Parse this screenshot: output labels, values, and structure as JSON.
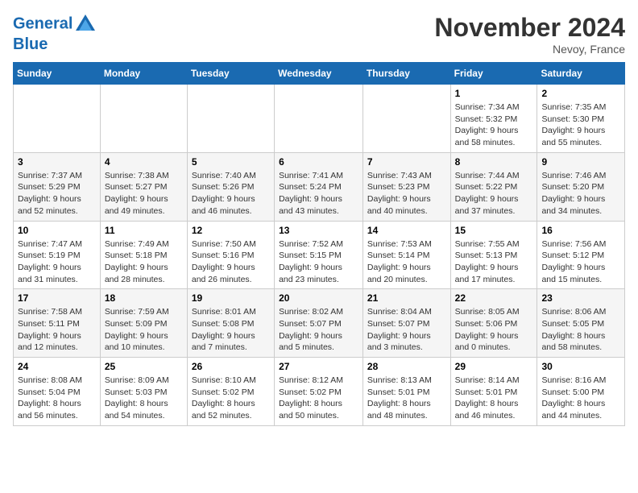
{
  "header": {
    "logo_line1": "General",
    "logo_line2": "Blue",
    "month": "November 2024",
    "location": "Nevoy, France"
  },
  "days_of_week": [
    "Sunday",
    "Monday",
    "Tuesday",
    "Wednesday",
    "Thursday",
    "Friday",
    "Saturday"
  ],
  "weeks": [
    [
      {
        "day": "",
        "info": ""
      },
      {
        "day": "",
        "info": ""
      },
      {
        "day": "",
        "info": ""
      },
      {
        "day": "",
        "info": ""
      },
      {
        "day": "",
        "info": ""
      },
      {
        "day": "1",
        "info": "Sunrise: 7:34 AM\nSunset: 5:32 PM\nDaylight: 9 hours and 58 minutes."
      },
      {
        "day": "2",
        "info": "Sunrise: 7:35 AM\nSunset: 5:30 PM\nDaylight: 9 hours and 55 minutes."
      }
    ],
    [
      {
        "day": "3",
        "info": "Sunrise: 7:37 AM\nSunset: 5:29 PM\nDaylight: 9 hours and 52 minutes."
      },
      {
        "day": "4",
        "info": "Sunrise: 7:38 AM\nSunset: 5:27 PM\nDaylight: 9 hours and 49 minutes."
      },
      {
        "day": "5",
        "info": "Sunrise: 7:40 AM\nSunset: 5:26 PM\nDaylight: 9 hours and 46 minutes."
      },
      {
        "day": "6",
        "info": "Sunrise: 7:41 AM\nSunset: 5:24 PM\nDaylight: 9 hours and 43 minutes."
      },
      {
        "day": "7",
        "info": "Sunrise: 7:43 AM\nSunset: 5:23 PM\nDaylight: 9 hours and 40 minutes."
      },
      {
        "day": "8",
        "info": "Sunrise: 7:44 AM\nSunset: 5:22 PM\nDaylight: 9 hours and 37 minutes."
      },
      {
        "day": "9",
        "info": "Sunrise: 7:46 AM\nSunset: 5:20 PM\nDaylight: 9 hours and 34 minutes."
      }
    ],
    [
      {
        "day": "10",
        "info": "Sunrise: 7:47 AM\nSunset: 5:19 PM\nDaylight: 9 hours and 31 minutes."
      },
      {
        "day": "11",
        "info": "Sunrise: 7:49 AM\nSunset: 5:18 PM\nDaylight: 9 hours and 28 minutes."
      },
      {
        "day": "12",
        "info": "Sunrise: 7:50 AM\nSunset: 5:16 PM\nDaylight: 9 hours and 26 minutes."
      },
      {
        "day": "13",
        "info": "Sunrise: 7:52 AM\nSunset: 5:15 PM\nDaylight: 9 hours and 23 minutes."
      },
      {
        "day": "14",
        "info": "Sunrise: 7:53 AM\nSunset: 5:14 PM\nDaylight: 9 hours and 20 minutes."
      },
      {
        "day": "15",
        "info": "Sunrise: 7:55 AM\nSunset: 5:13 PM\nDaylight: 9 hours and 17 minutes."
      },
      {
        "day": "16",
        "info": "Sunrise: 7:56 AM\nSunset: 5:12 PM\nDaylight: 9 hours and 15 minutes."
      }
    ],
    [
      {
        "day": "17",
        "info": "Sunrise: 7:58 AM\nSunset: 5:11 PM\nDaylight: 9 hours and 12 minutes."
      },
      {
        "day": "18",
        "info": "Sunrise: 7:59 AM\nSunset: 5:09 PM\nDaylight: 9 hours and 10 minutes."
      },
      {
        "day": "19",
        "info": "Sunrise: 8:01 AM\nSunset: 5:08 PM\nDaylight: 9 hours and 7 minutes."
      },
      {
        "day": "20",
        "info": "Sunrise: 8:02 AM\nSunset: 5:07 PM\nDaylight: 9 hours and 5 minutes."
      },
      {
        "day": "21",
        "info": "Sunrise: 8:04 AM\nSunset: 5:07 PM\nDaylight: 9 hours and 3 minutes."
      },
      {
        "day": "22",
        "info": "Sunrise: 8:05 AM\nSunset: 5:06 PM\nDaylight: 9 hours and 0 minutes."
      },
      {
        "day": "23",
        "info": "Sunrise: 8:06 AM\nSunset: 5:05 PM\nDaylight: 8 hours and 58 minutes."
      }
    ],
    [
      {
        "day": "24",
        "info": "Sunrise: 8:08 AM\nSunset: 5:04 PM\nDaylight: 8 hours and 56 minutes."
      },
      {
        "day": "25",
        "info": "Sunrise: 8:09 AM\nSunset: 5:03 PM\nDaylight: 8 hours and 54 minutes."
      },
      {
        "day": "26",
        "info": "Sunrise: 8:10 AM\nSunset: 5:02 PM\nDaylight: 8 hours and 52 minutes."
      },
      {
        "day": "27",
        "info": "Sunrise: 8:12 AM\nSunset: 5:02 PM\nDaylight: 8 hours and 50 minutes."
      },
      {
        "day": "28",
        "info": "Sunrise: 8:13 AM\nSunset: 5:01 PM\nDaylight: 8 hours and 48 minutes."
      },
      {
        "day": "29",
        "info": "Sunrise: 8:14 AM\nSunset: 5:01 PM\nDaylight: 8 hours and 46 minutes."
      },
      {
        "day": "30",
        "info": "Sunrise: 8:16 AM\nSunset: 5:00 PM\nDaylight: 8 hours and 44 minutes."
      }
    ]
  ]
}
